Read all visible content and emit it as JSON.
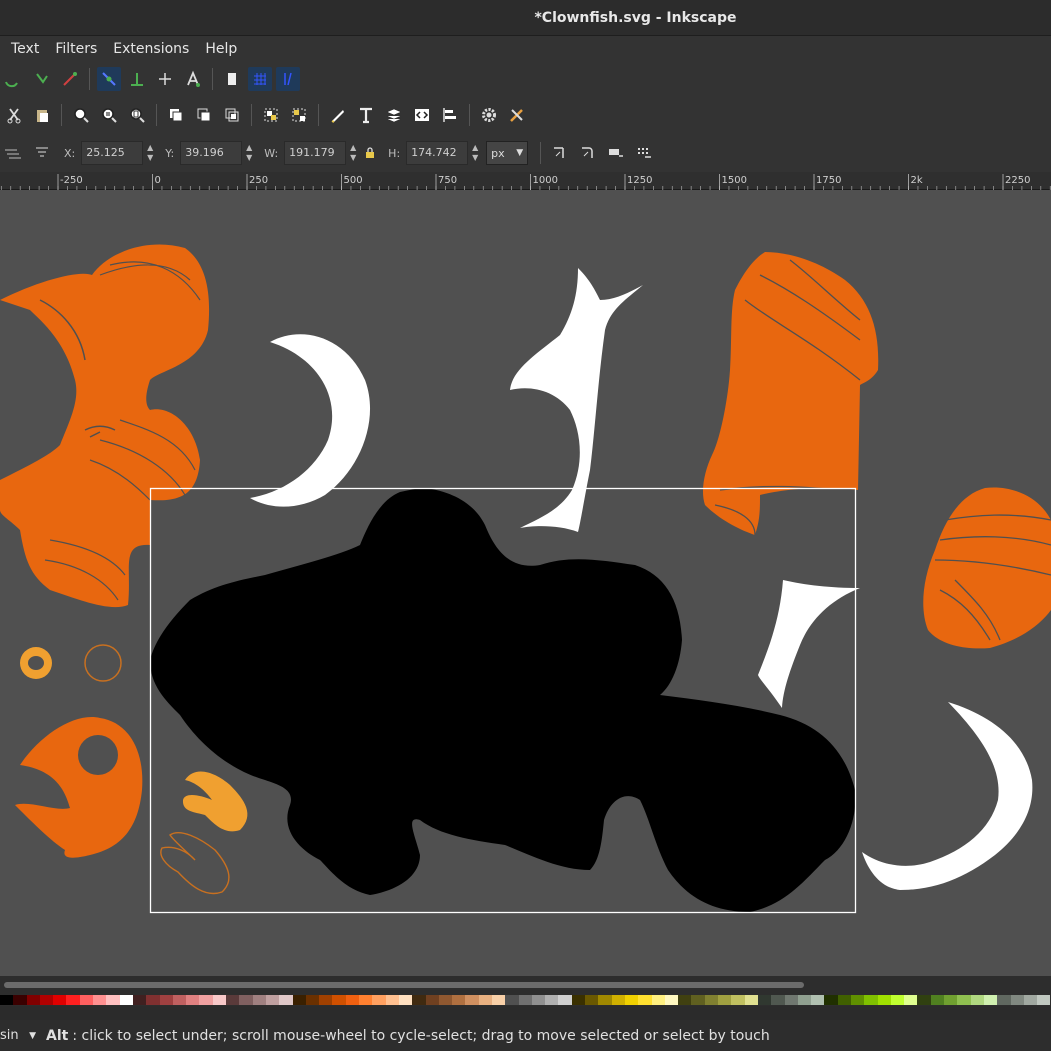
{
  "window": {
    "title": "*Clownfish.svg - Inkscape"
  },
  "menu": [
    "Text",
    "Filters",
    "Extensions",
    "Help"
  ],
  "toolbar_icons_1": [
    "snap-icon",
    "undo-path-icon",
    "pen-icon",
    "node-snap-icon",
    "bbox-icon",
    "guide-icon",
    "text-snap-icon",
    "page-icon",
    "grid-icon",
    "guides-icon"
  ],
  "toolbar_icons_2": [
    "cut-icon",
    "paste-icon",
    "zoom-icon",
    "zoom-drawing-icon",
    "zoom-page-icon",
    "duplicate-icon",
    "clone-icon",
    "unlink-icon",
    "group-icon",
    "ungroup-icon",
    "fill-stroke-icon",
    "text-font-icon",
    "layers-icon",
    "xml-editor-icon",
    "align-icon",
    "preferences-icon",
    "document-properties-icon"
  ],
  "selector": {
    "x_label": "X:",
    "x_value": "25.125",
    "y_label": "Y:",
    "y_value": "39.196",
    "w_label": "W:",
    "w_value": "191.179",
    "h_label": "H:",
    "h_value": "174.742",
    "unit": "px",
    "spin_up": "▲",
    "spin_down": "▼",
    "dropdown": "▼"
  },
  "ruler": {
    "labels": [
      "-250",
      "0",
      "250",
      "500",
      "750",
      "1000",
      "1250",
      "1500",
      "1750",
      "2k",
      "2250"
    ]
  },
  "colors": {
    "canvas": "#505050",
    "orange": "#e8670f",
    "light_orange": "#f0a030",
    "white": "#ffffff",
    "black": "#000000"
  },
  "status": {
    "layer": "sin",
    "dropdown": "▼",
    "key": "Alt",
    "message": ": click to select under; scroll mouse-wheel to cycle-select; drag to move selected or select by touch"
  }
}
